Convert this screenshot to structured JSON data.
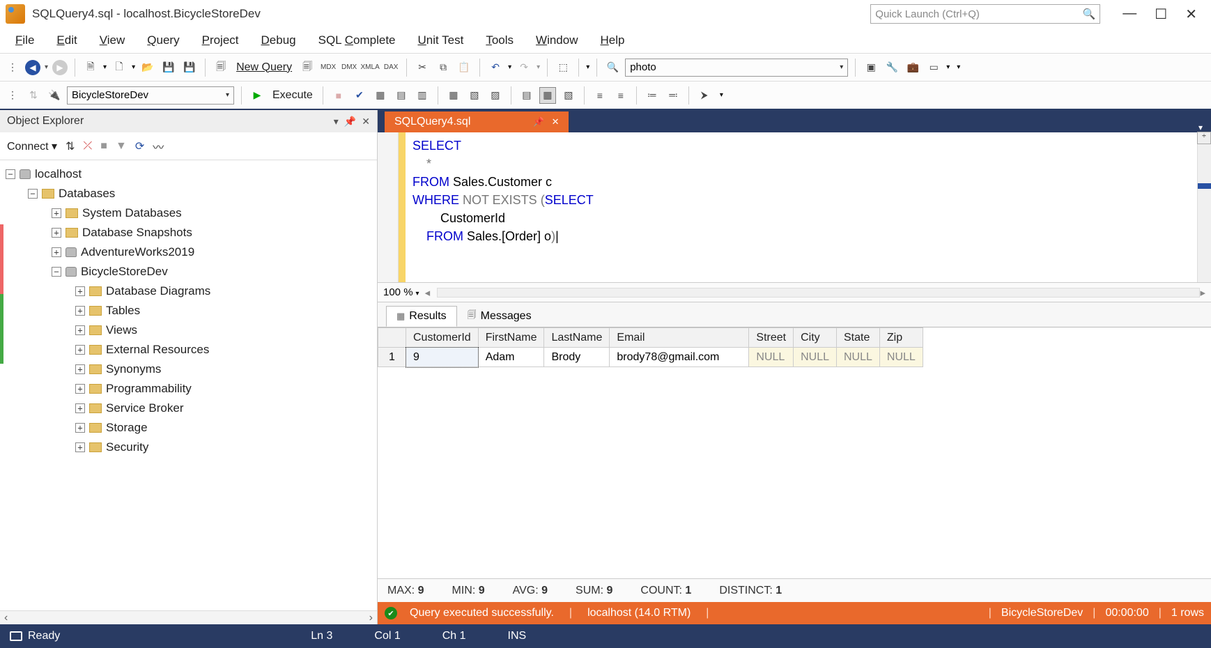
{
  "titlebar": {
    "title": "SQLQuery4.sql - localhost.BicycleStoreDev",
    "quick_launch_placeholder": "Quick Launch (Ctrl+Q)"
  },
  "menu": [
    "File",
    "Edit",
    "View",
    "Query",
    "Project",
    "Debug",
    "SQL Complete",
    "Unit Test",
    "Tools",
    "Window",
    "Help"
  ],
  "toolbar1": {
    "new_query": "New Query",
    "search_value": "photo"
  },
  "toolbar2": {
    "db_combo": "BicycleStoreDev",
    "execute": "Execute"
  },
  "object_explorer": {
    "title": "Object Explorer",
    "connect": "Connect",
    "root": "localhost",
    "databases": "Databases",
    "items_level3": [
      "System Databases",
      "Database Snapshots",
      "AdventureWorks2019",
      "BicycleStoreDev"
    ],
    "bsd_children": [
      "Database Diagrams",
      "Tables",
      "Views",
      "External Resources",
      "Synonyms",
      "Programmability",
      "Service Broker",
      "Storage",
      "Security"
    ]
  },
  "editor": {
    "tab_name": "SQLQuery4.sql",
    "code_lines": [
      {
        "pre": "",
        "kw": "SELECT",
        "rest": ""
      },
      {
        "pre": "    ",
        "kw": "",
        "rest": "*",
        "grey": true
      },
      {
        "pre": "",
        "kw": "FROM",
        "rest": " Sales.Customer c"
      },
      {
        "pre": "",
        "kw": "WHERE",
        "grey_mid": " NOT EXISTS ",
        "paren": "(",
        "kw2": "SELECT"
      },
      {
        "pre": "        ",
        "kw": "",
        "rest": "CustomerId"
      },
      {
        "pre": "    ",
        "kw": "FROM",
        "rest": " Sales.[Order] o",
        "paren_close": ")",
        "cursor": "|"
      }
    ],
    "zoom": "100 %"
  },
  "results": {
    "tab_results": "Results",
    "tab_messages": "Messages",
    "columns": [
      "CustomerId",
      "FirstName",
      "LastName",
      "Email",
      "Street",
      "City",
      "State",
      "Zip"
    ],
    "row_num": "1",
    "row": [
      "9",
      "Adam",
      "Brody",
      "brody78@gmail.com",
      "NULL",
      "NULL",
      "NULL",
      "NULL"
    ]
  },
  "aggregates": {
    "max": "MAX:",
    "max_v": "9",
    "min": "MIN:",
    "min_v": "9",
    "avg": "AVG:",
    "avg_v": "9",
    "sum": "SUM:",
    "sum_v": "9",
    "count": "COUNT:",
    "count_v": "1",
    "distinct": "DISTINCT:",
    "distinct_v": "1"
  },
  "exec_status": {
    "msg": "Query executed successfully.",
    "server": "localhost (14.0 RTM)",
    "db": "BicycleStoreDev",
    "time": "00:00:00",
    "rows": "1 rows"
  },
  "statusbar": {
    "ready": "Ready",
    "ln": "Ln 3",
    "col": "Col 1",
    "ch": "Ch 1",
    "ins": "INS"
  }
}
